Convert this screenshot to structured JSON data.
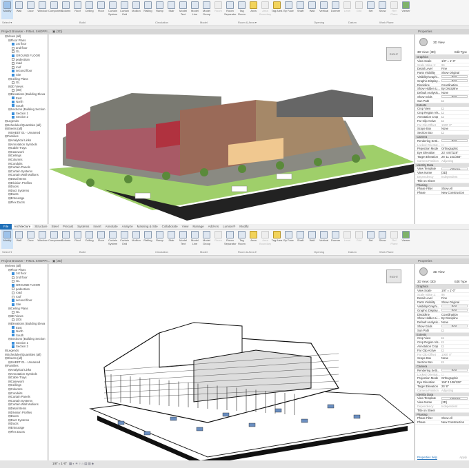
{
  "ribbon_tabs": [
    "File",
    "Architecture",
    "Structure",
    "Steel",
    "Precast",
    "Systems",
    "Insert",
    "Annotate",
    "Analyze",
    "Massing & Site",
    "Collaborate",
    "View",
    "Manage",
    "Add-Ins",
    "Lumion®",
    "Modify"
  ],
  "ribbon_tools": [
    {
      "label": "Modify",
      "k": "modify"
    },
    {
      "label": "Wall"
    },
    {
      "label": "Door"
    },
    {
      "label": "Window"
    },
    {
      "label": "Component"
    },
    {
      "label": "Column"
    },
    {
      "label": "Roof"
    },
    {
      "label": "Ceiling"
    },
    {
      "label": "Floor"
    },
    {
      "label": "Curtain System"
    },
    {
      "label": "Curtain Grid"
    },
    {
      "label": "Mullion"
    },
    {
      "label": "Railing"
    },
    {
      "label": "Ramp"
    },
    {
      "label": "Stair"
    },
    {
      "label": "Model Text"
    },
    {
      "label": "Model Line"
    },
    {
      "label": "Model Group"
    },
    {
      "label": "Room",
      "k": "dis"
    },
    {
      "label": "Room Separator"
    },
    {
      "label": "Tag Room"
    },
    {
      "label": "Area",
      "k": "yel"
    },
    {
      "label": "Area Boundary",
      "k": "dis"
    },
    {
      "label": "Tag Area",
      "k": "yel"
    },
    {
      "label": "By Face"
    },
    {
      "label": "Shaft"
    },
    {
      "label": "Wall"
    },
    {
      "label": "Vertical"
    },
    {
      "label": "Dormer"
    },
    {
      "label": "Level",
      "k": "dis"
    },
    {
      "label": "Grid",
      "k": "dis"
    },
    {
      "label": "Set"
    },
    {
      "label": "Show"
    },
    {
      "label": "Ref Plane",
      "k": "dis"
    },
    {
      "label": "Viewer",
      "k": "grn"
    }
  ],
  "ribbon_groups": [
    "Select ▾",
    "Build",
    "Circulation",
    "Model",
    "Room & Area ▾",
    "Opening",
    "Datum",
    "Work Plane"
  ],
  "browser_title": "Project Browser - FINAL SHOPPI...",
  "view_tab": "{3D}",
  "properties_title": "Properties",
  "browser_rows": [
    {
      "t": "Views (all)",
      "l": 1
    },
    {
      "t": "Floor Plans",
      "l": 2
    },
    {
      "t": "1st floor",
      "l": 3,
      "c": true
    },
    {
      "t": "2nd floor",
      "l": 3,
      "c": false
    },
    {
      "t": "GL",
      "l": 3,
      "c": false
    },
    {
      "t": "GROUND FLOOR",
      "l": 3,
      "c": true
    },
    {
      "t": "pedestrian",
      "l": 3,
      "c": false
    },
    {
      "t": "road",
      "l": 3,
      "c": false
    },
    {
      "t": "roof",
      "l": 3,
      "c": false
    },
    {
      "t": "second floor",
      "l": 3,
      "c": true
    },
    {
      "t": "Site",
      "l": 3,
      "c": true
    },
    {
      "t": "Ceiling Plans",
      "l": 2
    },
    {
      "t": "GL",
      "l": 3,
      "c": false
    },
    {
      "t": "3D Views",
      "l": 2
    },
    {
      "t": "{3D}",
      "l": 3,
      "c": false
    },
    {
      "t": "Elevations (Building Eleva",
      "l": 2
    },
    {
      "t": "East",
      "l": 3,
      "c": true
    },
    {
      "t": "North",
      "l": 3,
      "c": true
    },
    {
      "t": "South",
      "l": 3,
      "c": true
    },
    {
      "t": "Sections (Building Section",
      "l": 2
    },
    {
      "t": "Section 1",
      "l": 3,
      "c": true
    },
    {
      "t": "Section 2",
      "l": 3,
      "c": true
    },
    {
      "t": "Legends",
      "l": 1
    },
    {
      "t": "Schedules/Quantities (all)",
      "l": 1
    },
    {
      "t": "Sheets (all)",
      "l": 1
    },
    {
      "t": "SHEET 01 - Unnamed",
      "l": 2
    },
    {
      "t": "Families",
      "l": 1
    },
    {
      "t": "Analytical Links",
      "l": 2
    },
    {
      "t": "Annotation Symbols",
      "l": 2
    },
    {
      "t": "Cable Trays",
      "l": 2
    },
    {
      "t": "Casework",
      "l": 2
    },
    {
      "t": "Ceilings",
      "l": 2
    },
    {
      "t": "Columns",
      "l": 2
    },
    {
      "t": "Conduits",
      "l": 2
    },
    {
      "t": "Curtain Panels",
      "l": 2
    },
    {
      "t": "Curtain Systems",
      "l": 2
    },
    {
      "t": "Curtain Wall Mullions",
      "l": 2
    },
    {
      "t": "Detail Items",
      "l": 2
    },
    {
      "t": "Division Profiles",
      "l": 2
    },
    {
      "t": "Doors",
      "l": 2
    },
    {
      "t": "Duct Systems",
      "l": 2
    },
    {
      "t": "Ducts",
      "l": 2
    },
    {
      "t": "Entourage",
      "l": 2
    },
    {
      "t": "Flex Ducts",
      "l": 2
    }
  ],
  "props_type": "3D View",
  "props_selector": "3D View: {3D}",
  "props_edit_type": "Edit Type",
  "props_top": [
    {
      "sec": "Graphics"
    },
    {
      "k": "View Scale",
      "v": "1/8\" = 1'-0\""
    },
    {
      "k": "Scale Value 1:",
      "v": "96",
      "d": true
    },
    {
      "k": "Detail Level",
      "v": "Fine"
    },
    {
      "k": "Parts Visibility",
      "v": "Show Original"
    },
    {
      "k": "Visibility/Graphi...",
      "v": "Edit...",
      "b": true
    },
    {
      "k": "Graphic Display...",
      "v": "Edit...",
      "b": true
    },
    {
      "k": "Discipline",
      "v": "Coordination"
    },
    {
      "k": "Show Hidden Li...",
      "v": "By Discipline"
    },
    {
      "k": "Default Analysis...",
      "v": "None"
    },
    {
      "k": "Show Grids",
      "v": "Edit...",
      "b": true
    },
    {
      "k": "Sun Path",
      "v": "☐"
    },
    {
      "sec": "Extents"
    },
    {
      "k": "Crop View",
      "v": "☐"
    },
    {
      "k": "Crop Region Vis...",
      "v": "☐"
    },
    {
      "k": "Annotation Crop",
      "v": "☐"
    },
    {
      "k": "Far Clip Active",
      "v": "☐"
    },
    {
      "k": "Far Clip Offset",
      "v": "1000' 0\"",
      "d": true
    },
    {
      "k": "Scope Box",
      "v": "None"
    },
    {
      "k": "Section Box",
      "v": "☐"
    },
    {
      "sec": "Camera"
    },
    {
      "k": "Rendering Setti...",
      "v": "Edit...",
      "b": true
    },
    {
      "k": "Locked Orientat...",
      "v": "☐",
      "d": true
    },
    {
      "k": "Projection Mode",
      "v": "Orthographic"
    },
    {
      "k": "Eye Elevation",
      "v": "23' 4 87/128\""
    },
    {
      "k": "Target Elevation",
      "v": "26' 11 151/256\""
    },
    {
      "k": "Camera Position",
      "v": "Adjusting",
      "d": true
    },
    {
      "sec": "Identity Data"
    },
    {
      "k": "View Template",
      "v": "<None>",
      "b": true
    },
    {
      "k": "View Name",
      "v": "{3D}"
    },
    {
      "k": "Dependency",
      "v": "Independent",
      "d": true
    },
    {
      "k": "Title on Sheet",
      "v": ""
    },
    {
      "sec": "Phasing"
    },
    {
      "k": "Phase Filter",
      "v": "Show All"
    },
    {
      "k": "Phase",
      "v": "New Construction"
    }
  ],
  "props_bottom_eye": "158' 3 108/128\"",
  "props_bottom_target": "25' 8\"",
  "properties_help": "Properties help",
  "apply": "Apply",
  "status_scale": "1/8\" = 1'-0\"",
  "viewcube_label": "RIGHT",
  "colors": {
    "accent": "#1e6fb8",
    "check": "#3a8fdc"
  }
}
